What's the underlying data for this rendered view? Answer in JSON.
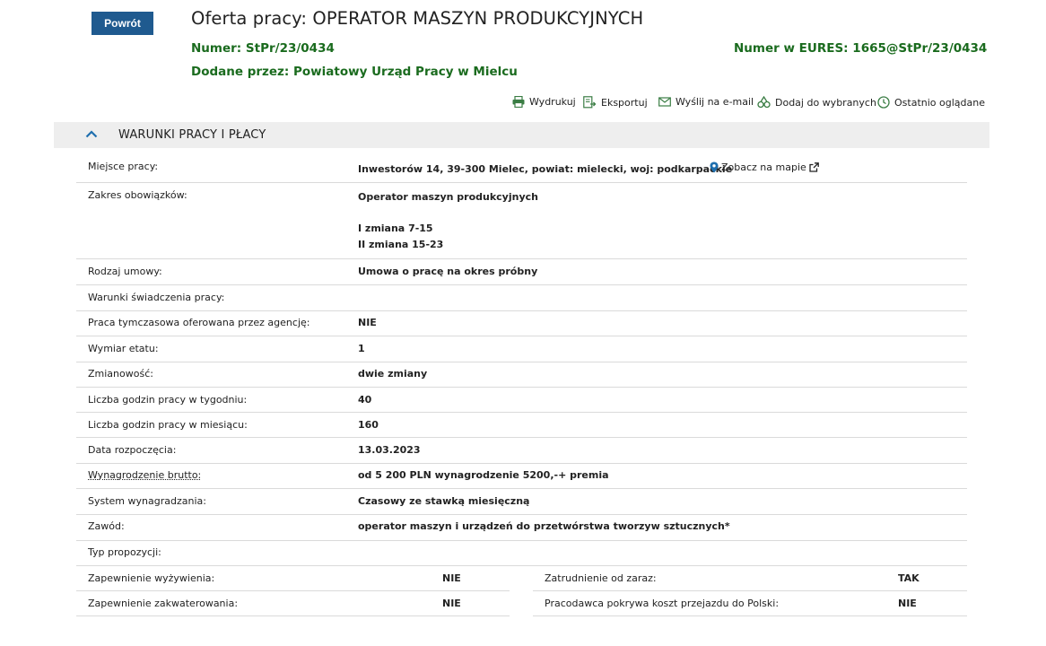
{
  "header": {
    "back_label": "Powrót",
    "title": "Oferta pracy: OPERATOR MASZYN PRODUKCYJNYCH",
    "numer_label": "Numer:",
    "numer_value": "StPr/23/0434",
    "eures_label": "Numer w EURES:",
    "eures_value": "1665@StPr/23/0434",
    "dodane_label": "Dodane przez:",
    "dodane_value": "Powiatowy Urząd Pracy w Mielcu"
  },
  "actions": {
    "print": "Wydrukuj",
    "export": "Eksportuj",
    "email": "Wyślij na e-mail",
    "favorite": "Dodaj do wybranych",
    "recent": "Ostatnio oglądane"
  },
  "section": {
    "title": "WARUNKI PRACY I PŁACY"
  },
  "details": {
    "miejsce_label": "Miejsce pracy:",
    "miejsce_value": "Inwestorów 14, 39-300 Mielec, powiat: mielecki, woj: podkarpackie",
    "map_link": "Zobacz na mapie",
    "zakres_label": "Zakres obowiązków:",
    "zakres_line1": "Operator maszyn produkcyjnych",
    "zakres_line2": "I zmiana 7-15",
    "zakres_line3": "II zmiana 15-23",
    "umowa_label": "Rodzaj umowy:",
    "umowa_value": "Umowa o pracę na okres próbny",
    "warunki_label": "Warunki świadczenia pracy:",
    "warunki_value": "",
    "agencja_label": "Praca tymczasowa oferowana przez agencję:",
    "agencja_value": "NIE",
    "wymiar_label": "Wymiar etatu:",
    "wymiar_value": "1",
    "zmianowosc_label": "Zmianowość:",
    "zmianowosc_value": "dwie zmiany",
    "godz_tydz_label": "Liczba godzin pracy w tygodniu:",
    "godz_tydz_value": "40",
    "godz_mies_label": "Liczba godzin pracy w miesiącu:",
    "godz_mies_value": "160",
    "data_label": "Data rozpoczęcia:",
    "data_value": "13.03.2023",
    "wynagrodzenie_label": "Wynagrodzenie brutto:",
    "wynagrodzenie_value": "od 5 200 PLN wynagrodzenie 5200,-+ premia",
    "system_label": "System wynagradzania:",
    "system_value": "Czasowy ze stawką miesięczną",
    "zawod_label": "Zawód:",
    "zawod_value": "operator maszyn i urządzeń do przetwórstwa tworzyw sztucznych*",
    "typ_label": "Typ propozycji:",
    "typ_value": "",
    "wyzywienie_label": "Zapewnienie wyżywienia:",
    "wyzywienie_value": "NIE",
    "zakwaterowanie_label": "Zapewnienie zakwaterowania:",
    "zakwaterowanie_value": "NIE",
    "od_zaraz_label": "Zatrudnienie od zaraz:",
    "od_zaraz_value": "TAK",
    "przejazd_label": "Pracodawca pokrywa koszt przejazdu do Polski:",
    "przejazd_value": "NIE"
  },
  "colors": {
    "button_bg": "#1f5a8f",
    "green_text": "#1a6b1e",
    "icon_green": "#3a7d44",
    "section_bg": "#eeeeee",
    "chevron": "#1f6fae",
    "map_pin": "#1f6fae"
  }
}
